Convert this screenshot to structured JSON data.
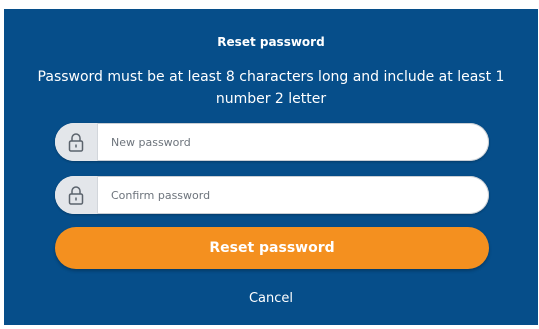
{
  "dialog": {
    "title": "Reset password",
    "description": "Password must be at least 8 characters long and include at least 1 number 2 letter",
    "new_password": {
      "placeholder": "New password",
      "value": "",
      "icon": "lock-icon"
    },
    "confirm_password": {
      "placeholder": "Confirm password",
      "value": "",
      "icon": "lock-icon"
    },
    "reset_button_label": "Reset password",
    "cancel_label": "Cancel"
  },
  "colors": {
    "background": "#064e8a",
    "button": "#f4901f",
    "text": "#ffffff"
  }
}
